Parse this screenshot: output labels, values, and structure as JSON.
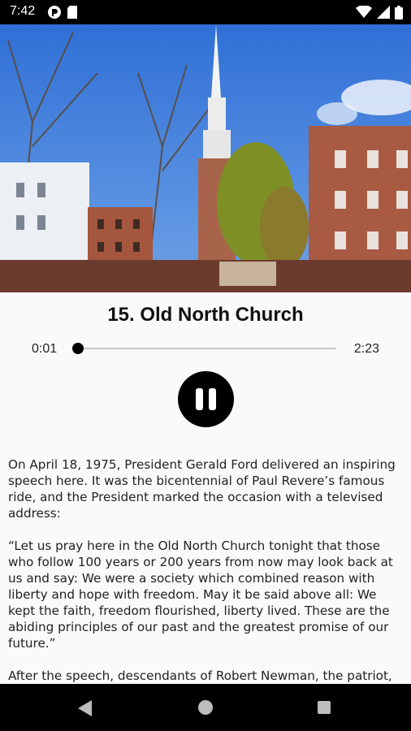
{
  "status_bar": {
    "time": "7:42",
    "left_icons": [
      "app-notification-icon",
      "sd-card-icon"
    ],
    "right_icons": [
      "wifi-icon",
      "signal-icon",
      "battery-icon"
    ]
  },
  "hero": {
    "image": "old-north-church-photo"
  },
  "player": {
    "title": "15. Old North Church",
    "current_time": "0:01",
    "total_time": "2:23",
    "progress_fraction": 0.007,
    "control_icon": "pause-icon"
  },
  "description": {
    "paragraphs": [
      "On April 18, 1975, President Gerald Ford delivered an inspiring speech here. It was the bicentennial of Paul Revere’s famous ride, and the President marked the occasion with a televised address:",
      "“Let us pray here in the Old North Church tonight that those who follow 100 years or 200 years from now may look back at us and say: We were a society which combined reason with liberty and hope with freedom. May it be said above all: We kept the faith, freedom flourished, liberty lived. These are the abiding principles of our past and the greatest promise of our future.”",
      "After the speech, descendants of Robert Newman, the patriot,"
    ]
  },
  "nav_bar": {
    "icons": [
      "back-icon",
      "home-icon",
      "recents-icon"
    ]
  }
}
